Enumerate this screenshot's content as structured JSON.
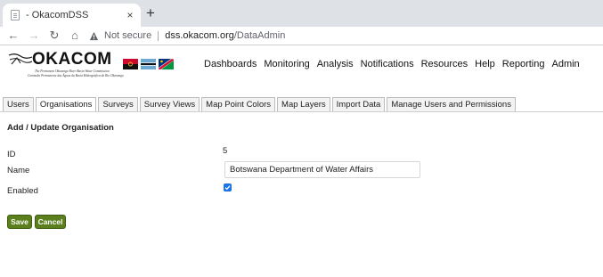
{
  "browser": {
    "tab_title": "- OkacomDSS",
    "tab_close": "×",
    "new_tab": "+",
    "nav": {
      "back": "←",
      "forward": "→",
      "reload": "↻",
      "home": "⌂"
    },
    "security_label": "Not secure",
    "url_host": "dss.okacom.org",
    "url_path": "/DataAdmin"
  },
  "site": {
    "logo_text": "OKACOM",
    "logo_sub1": "The Permanent Okavango River Basin Water Commission",
    "logo_sub2": "Comissão Permanente das Águas da Bacia Hidrográfica do Rio Okavango",
    "flags": [
      "angola-flag",
      "botswana-flag",
      "namibia-flag"
    ],
    "nav": [
      "Dashboards",
      "Monitoring",
      "Analysis",
      "Notifications",
      "Resources",
      "Help",
      "Reporting",
      "Admin"
    ]
  },
  "page_tabs": [
    {
      "label": "Users",
      "active": false
    },
    {
      "label": "Organisations",
      "active": true
    },
    {
      "label": "Surveys",
      "active": false
    },
    {
      "label": "Survey Views",
      "active": false
    },
    {
      "label": "Map Point Colors",
      "active": false
    },
    {
      "label": "Map Layers",
      "active": false
    },
    {
      "label": "Import Data",
      "active": false
    },
    {
      "label": "Manage Users and Permissions",
      "active": false
    }
  ],
  "form": {
    "title": "Add / Update Organisation",
    "id_label": "ID",
    "id_value": "5",
    "name_label": "Name",
    "name_value": "Botswana Department of Water Affairs",
    "enabled_label": "Enabled",
    "enabled": true,
    "save_label": "Save",
    "cancel_label": "Cancel"
  },
  "colors": {
    "button_green": "#5a7f1c",
    "checkbox_blue": "#1a73e8",
    "tabstrip": "#dee1e6"
  }
}
